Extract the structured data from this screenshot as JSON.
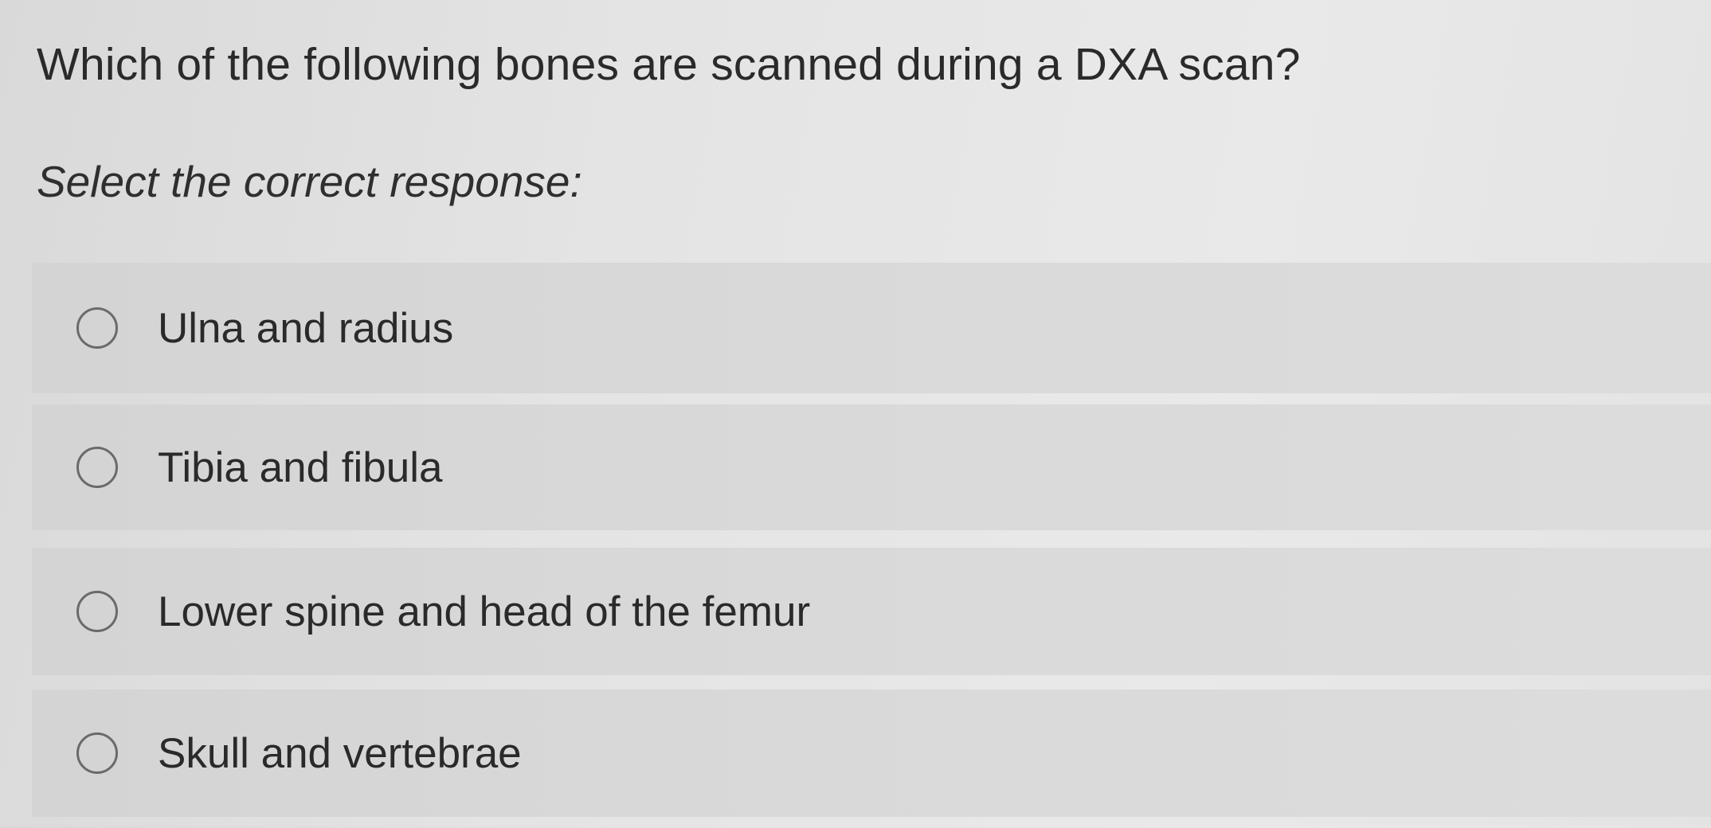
{
  "question": {
    "text": "Which of the following bones are scanned during a DXA scan?",
    "instruction": "Select the correct response:"
  },
  "options": [
    {
      "label": "Ulna and radius",
      "selected": false
    },
    {
      "label": "Tibia and fibula",
      "selected": false
    },
    {
      "label": "Lower spine and head of the femur",
      "selected": false
    },
    {
      "label": "Skull and vertebrae",
      "selected": false
    }
  ],
  "colors": {
    "background": "#e4e4e4",
    "option_background": "#d9d9d9",
    "text": "#2a2a2a",
    "radio_border": "#6a6a6a"
  }
}
